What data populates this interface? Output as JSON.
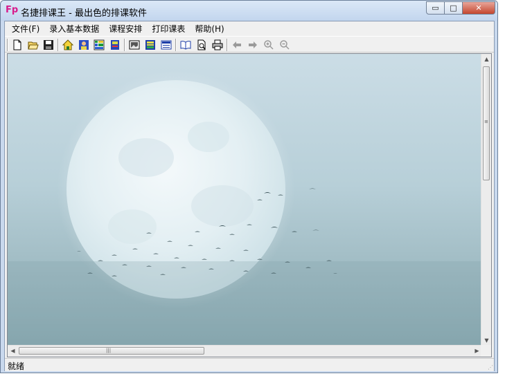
{
  "window": {
    "title": "名捷排课王 - 最出色的排课软件",
    "app_icon_text": "Fp",
    "controls": {
      "minimize": "▭",
      "maximize": "□",
      "close": "✕"
    }
  },
  "menu": {
    "items": [
      {
        "label": "文件(F)"
      },
      {
        "label": "录入基本数据"
      },
      {
        "label": "课程安排"
      },
      {
        "label": "打印课表"
      },
      {
        "label": "帮助(H)"
      }
    ]
  },
  "toolbar": {
    "buttons": [
      "new-file-icon",
      "open-folder-icon",
      "save-icon",
      "home-icon",
      "teacher-icon",
      "schedule-grid-icon",
      "class-book-icon",
      "classroom-image-icon",
      "timetable-icon",
      "report-icon",
      "open-book-icon",
      "print-preview-icon",
      "print-icon",
      "arrow-left-icon",
      "arrow-right-icon",
      "zoom-in-icon",
      "zoom-out-icon"
    ]
  },
  "scrollbars": {
    "up": "▲",
    "down": "▼",
    "left": "◀",
    "right": "▶",
    "vgrip": "≡",
    "hgrip": "|||"
  },
  "status": {
    "text": "就绪"
  }
}
